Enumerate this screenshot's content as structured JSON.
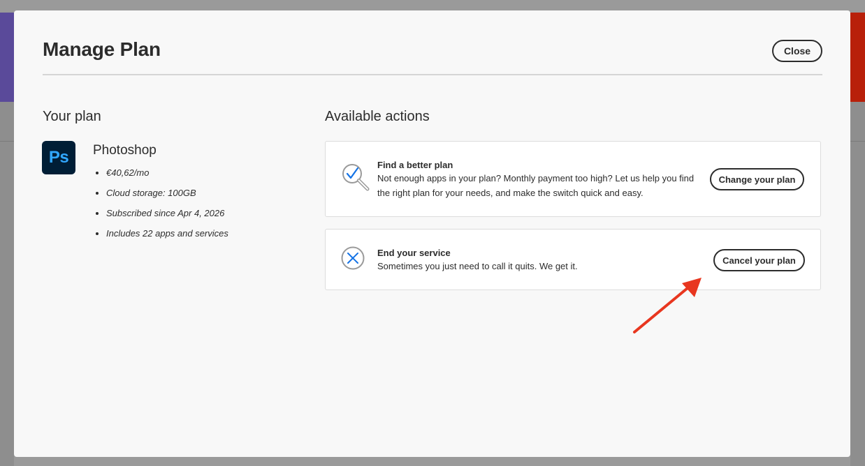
{
  "modal": {
    "title": "Manage Plan",
    "close_label": "Close"
  },
  "your_plan": {
    "heading": "Your plan",
    "logo_text": "Ps",
    "product_name": "Photoshop",
    "details": [
      "€40,62/mo",
      "Cloud storage: 100GB",
      "Subscribed since Apr 4, 2026",
      "Includes 22 apps and services"
    ]
  },
  "actions": {
    "heading": "Available actions",
    "items": [
      {
        "icon": "magnifier-check-icon",
        "title": "Find a better plan",
        "description": "Not enough apps in your plan? Monthly payment too high? Let us help you find the right plan for your needs, and make the switch quick and easy.",
        "button_label": "Change your plan"
      },
      {
        "icon": "circle-x-icon",
        "title": "End your service",
        "description": "Sometimes you just need to call it quits. We get it.",
        "button_label": "Cancel your plan"
      }
    ]
  },
  "colors": {
    "overlay": "#9a9a9a",
    "modal_bg": "#f8f8f8",
    "text": "#2c2c2c",
    "ps_logo_bg": "#001e36",
    "ps_logo_text": "#31a8ff",
    "icon_blue": "#1473e6",
    "annotation_arrow": "#e8361f"
  }
}
